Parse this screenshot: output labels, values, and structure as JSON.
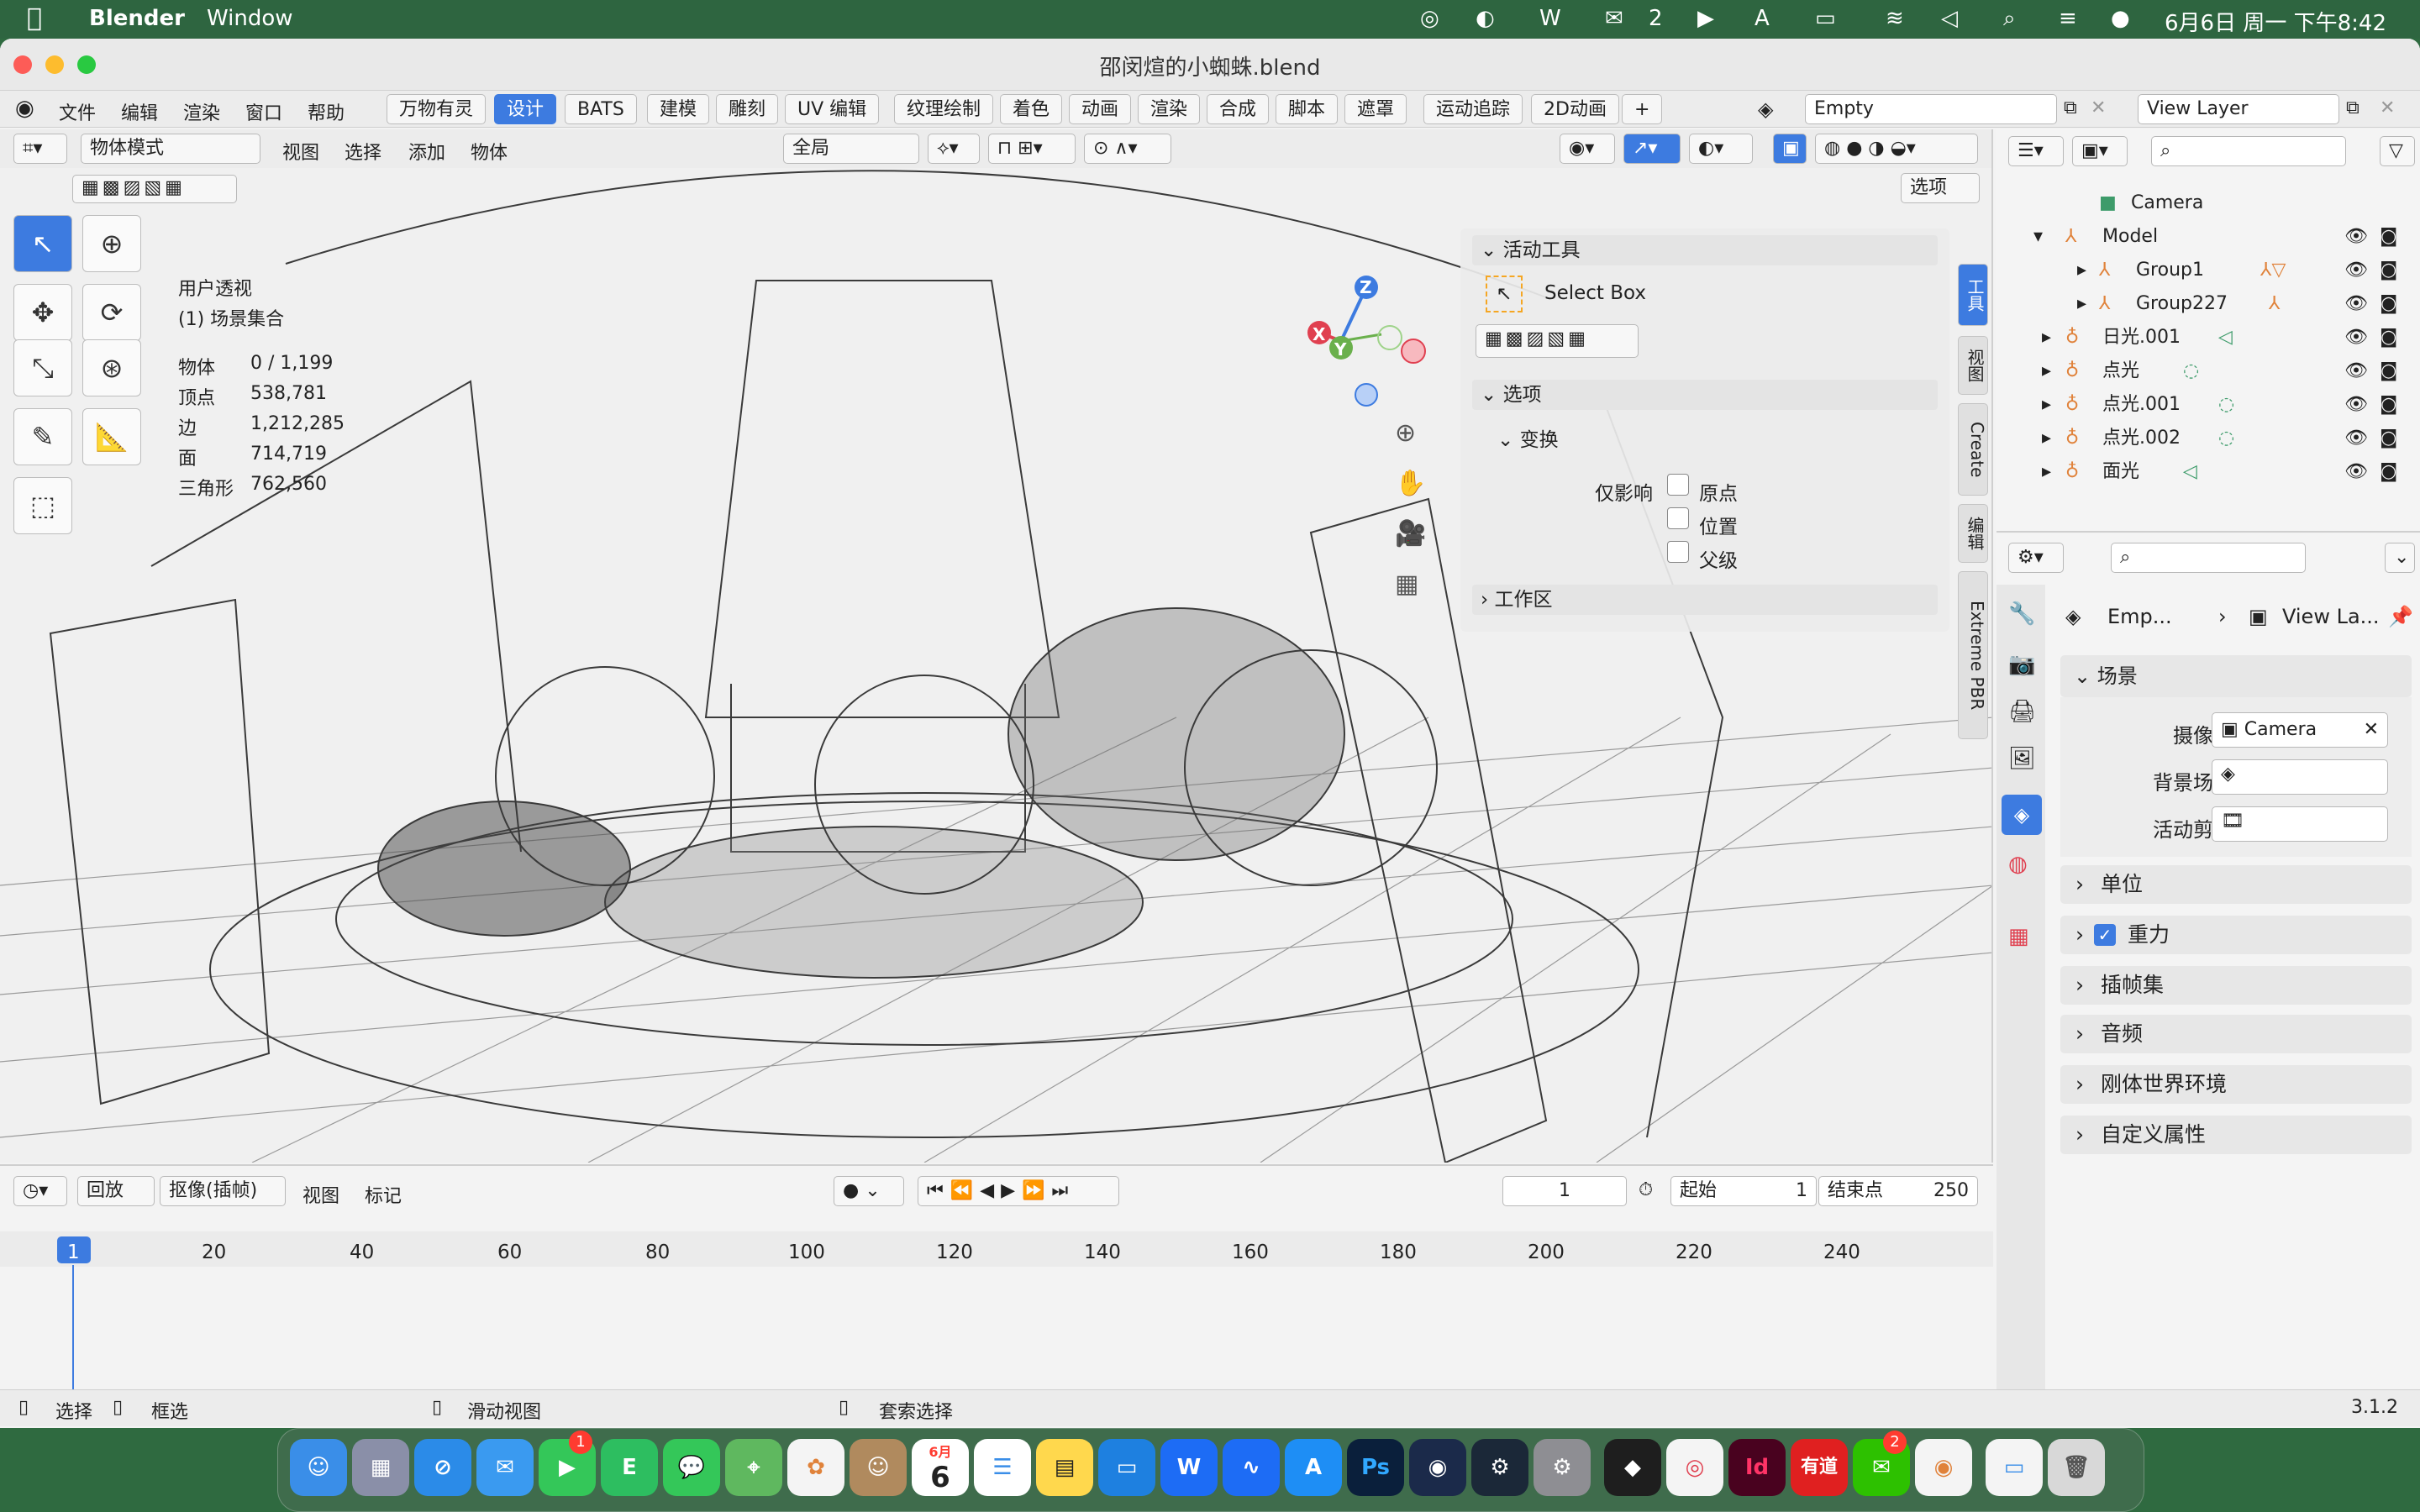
{
  "menubar": {
    "apple_icon": "apple-icon",
    "app_name": "Blender",
    "window_menu": "Window",
    "datetime": "6月6日 周一 下午8:42",
    "wechat_badge": "2"
  },
  "window": {
    "title": "邵闵煊的小蜘蛛.blend",
    "menus": [
      "文件",
      "编辑",
      "渲染",
      "窗口",
      "帮助"
    ],
    "workspaces": [
      "万物有灵",
      "设计",
      "BATS",
      "建模",
      "雕刻",
      "UV 编辑",
      "纹理绘制",
      "着色",
      "动画",
      "渲染",
      "合成",
      "脚本",
      "遮罩",
      "运动追踪",
      "2D动画",
      "+"
    ],
    "active_workspace": "设计",
    "scene_field": "Empty",
    "view_layer_field": "View Layer"
  },
  "viewport": {
    "mode": "物体模式",
    "menus": [
      "视图",
      "选择",
      "添加",
      "物体"
    ],
    "orientation": "全局",
    "options_button": "选项",
    "view_name": "用户透视",
    "collection": "(1) 场景集合",
    "stats": [
      {
        "label": "物体",
        "value": "0 / 1,199"
      },
      {
        "label": "顶点",
        "value": "538,781"
      },
      {
        "label": "边",
        "value": "1,212,285"
      },
      {
        "label": "面",
        "value": "714,719"
      },
      {
        "label": "三角形",
        "value": "762,560"
      }
    ],
    "gizmo": {
      "z": "Z",
      "y": "Y",
      "x": "X"
    }
  },
  "npanel": {
    "active_tool_header": "活动工具",
    "tool_name": "Select Box",
    "options_header": "选项",
    "transform_header": "变换",
    "affect_only": "仅影响",
    "checkboxes": [
      "原点",
      "位置",
      "父级"
    ],
    "workspace_header": "工作区",
    "tabs": [
      "工具",
      "视图",
      "Create",
      "编辑",
      "Extreme PBR"
    ]
  },
  "outliner": {
    "items": [
      {
        "label": "Camera",
        "type": "camera"
      },
      {
        "label": "Model",
        "type": "empty"
      },
      {
        "label": "Group1",
        "type": "empty"
      },
      {
        "label": "Group227",
        "type": "empty"
      },
      {
        "label": "日光.001",
        "type": "light"
      },
      {
        "label": "点光",
        "type": "light"
      },
      {
        "label": "点光.001",
        "type": "light"
      },
      {
        "label": "点光.002",
        "type": "light"
      },
      {
        "label": "面光",
        "type": "light"
      }
    ]
  },
  "properties": {
    "breadcrumb_1": "Emp...",
    "breadcrumb_2": "View La...",
    "scene_header": "场景",
    "camera_label": "摄像机",
    "camera_value": "Camera",
    "background_label": "背景场景",
    "clip_label": "活动剪辑",
    "sections": [
      "单位",
      "重力",
      "插帧集",
      "音频",
      "刚体世界环境",
      "自定义属性"
    ]
  },
  "timeline": {
    "playback": "回放",
    "keying": "抠像(插帧)",
    "view": "视图",
    "marker": "标记",
    "current_frame": "1",
    "start_label": "起始",
    "start_value": "1",
    "end_label": "结束点",
    "end_value": "250",
    "ticks": [
      "1",
      "20",
      "40",
      "60",
      "80",
      "100",
      "120",
      "140",
      "160",
      "180",
      "200",
      "220",
      "240"
    ]
  },
  "statusbar": {
    "select": "选择",
    "box_select": "框选",
    "pan_view": "滑动视图",
    "lasso": "套索选择",
    "version": "3.1.2"
  },
  "dock": {
    "apps": [
      "Finder",
      "Launchpad",
      "Safari",
      "Mail",
      "FaceTime",
      "Evernote",
      "Messages",
      "Maps",
      "Photos",
      "Contacts",
      "Calendar",
      "Reminders",
      "Notes",
      "Keynote",
      "WPS",
      "Freeform",
      "App Store",
      "Photoshop",
      "Cinema 4D",
      "Steam",
      "Settings",
      "Figma",
      "Chrome",
      "InDesign",
      "有道",
      "WeChat",
      "Blender",
      "Preview",
      "Trash"
    ],
    "calendar_month": "6月",
    "calendar_day": "6",
    "facetime_badge": "1",
    "wechat_badge": "2"
  },
  "colors": {
    "accent": "#3d7be0",
    "desktop": "#2e6540",
    "axis_x": "#e04050",
    "axis_y": "#6ab04c",
    "axis_z": "#3d7be0"
  }
}
